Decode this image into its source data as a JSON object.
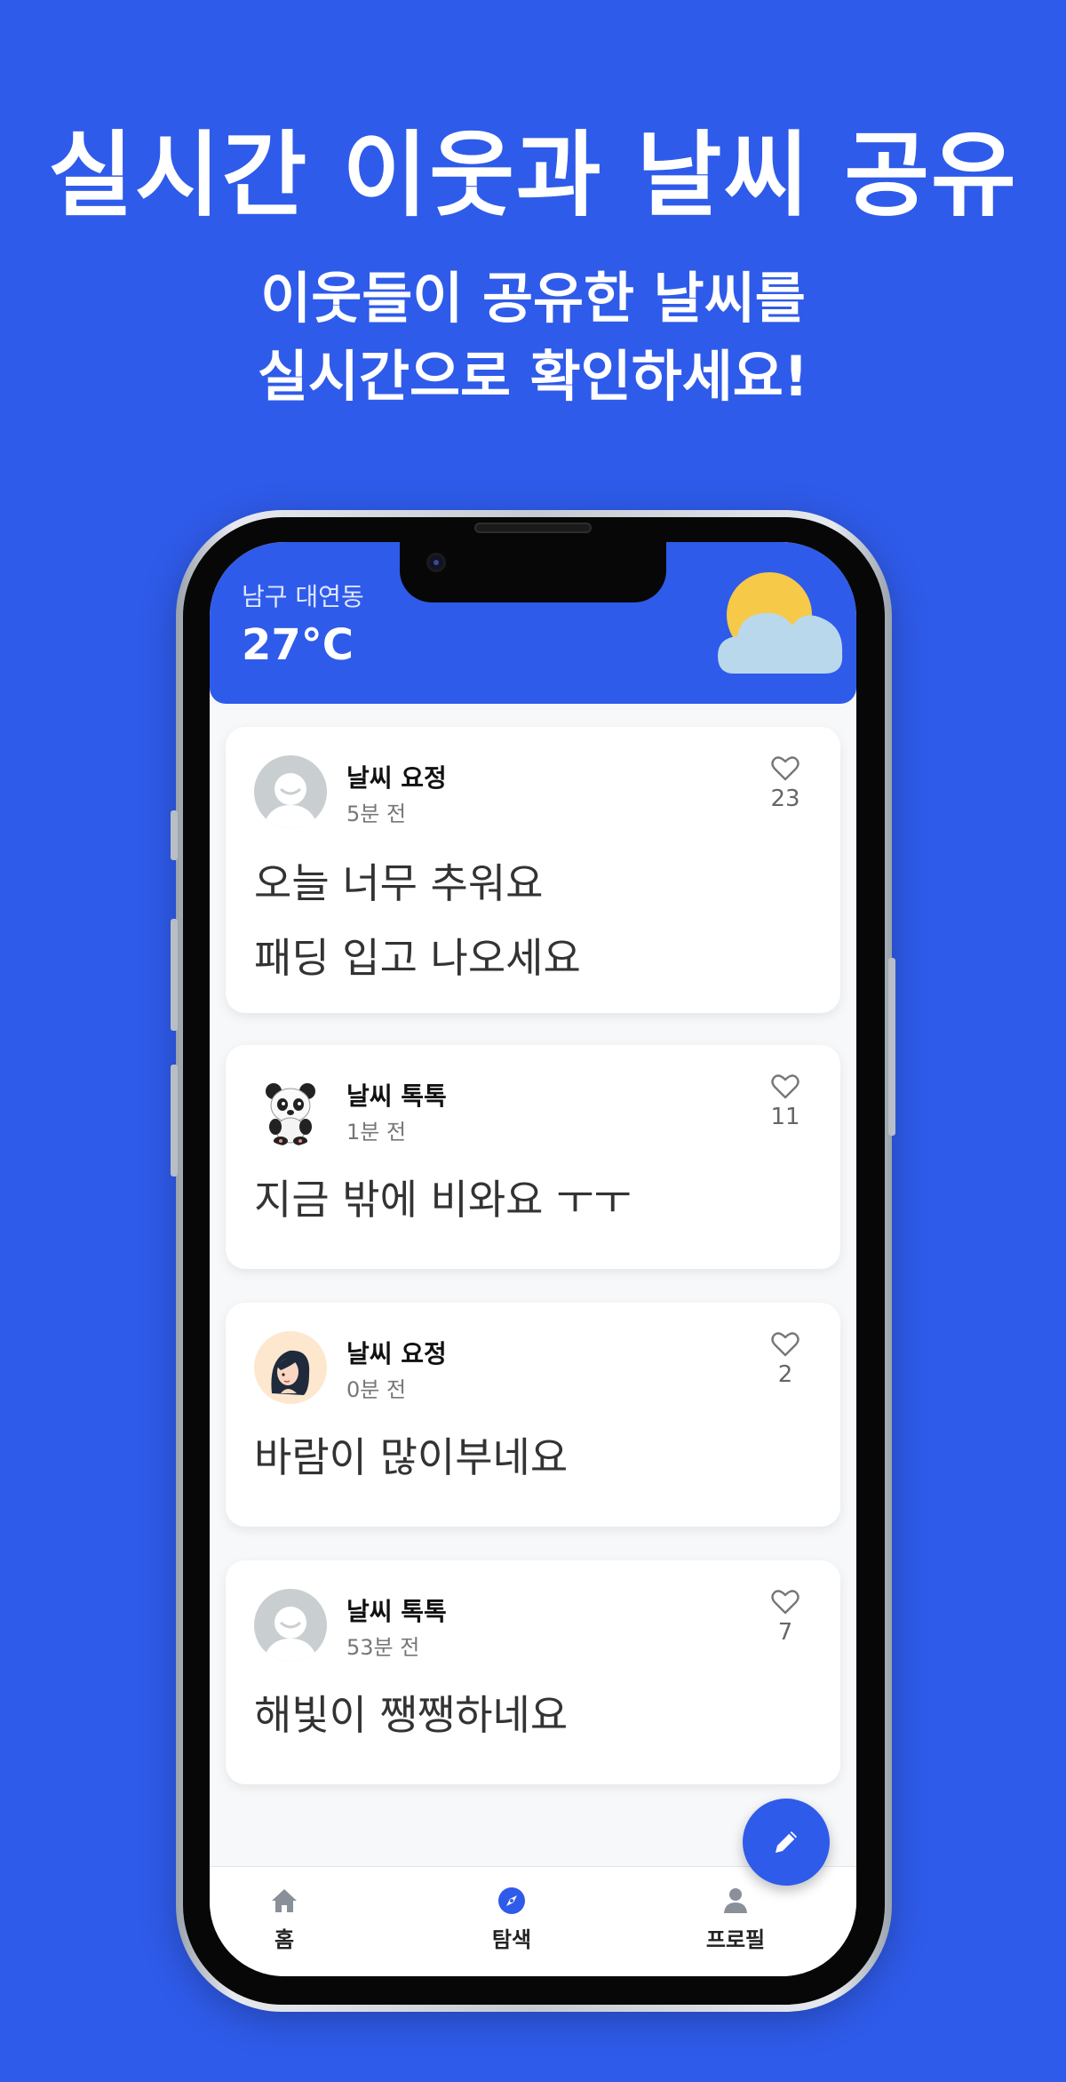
{
  "promo": {
    "headline": "실시간 이웃과 날씨 공유",
    "subline_1": "이웃들이 공유한 날씨를",
    "subline_2": "실시간으로 확인하세요!"
  },
  "header": {
    "location": "남구 대연동",
    "temperature": "27°C",
    "weather_icon": "partly-cloudy-icon"
  },
  "posts": [
    {
      "author": "날씨 요정",
      "time": "5분 전",
      "likes": "23",
      "avatar": "default-avatar",
      "lines": [
        "오늘 너무 추워요",
        "패딩 입고 나오세요"
      ]
    },
    {
      "author": "날씨 톡톡",
      "time": "1분 전",
      "likes": "11",
      "avatar": "panda-avatar",
      "lines": [
        "지금 밖에 비와요 ㅜㅜ"
      ]
    },
    {
      "author": "날씨 요정",
      "time": "0분 전",
      "likes": "2",
      "avatar": "girl-avatar",
      "lines": [
        "바람이 많이부네요"
      ]
    },
    {
      "author": "날씨 톡톡",
      "time": "53분 전",
      "likes": "7",
      "avatar": "default-avatar",
      "lines": [
        "해빛이 쨍쨍하네요"
      ]
    }
  ],
  "fab": {
    "icon": "pencil-icon"
  },
  "nav": [
    {
      "label": "홈",
      "icon": "home-icon"
    },
    {
      "label": "탐색",
      "icon": "compass-icon"
    },
    {
      "label": "프로필",
      "icon": "person-icon"
    }
  ],
  "colors": {
    "brand": "#2f5bea",
    "card": "#ffffff",
    "background": "#f7f8fa"
  }
}
